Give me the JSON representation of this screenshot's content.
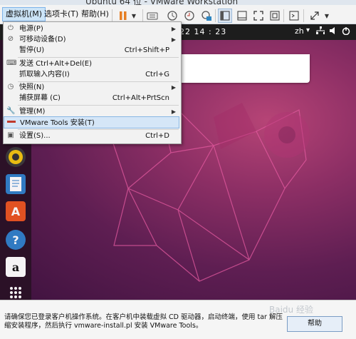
{
  "window": {
    "title": "Ubuntu 64 位 - VMware Workstation"
  },
  "menubar": {
    "items": [
      "虚拟机(M)",
      "选项卡(T)",
      "帮助(H)"
    ]
  },
  "vm": {
    "clock": "22 14 : 23",
    "lang": "zh",
    "tray_icons": [
      "network-icon",
      "volume-icon",
      "power-icon"
    ]
  },
  "dock": {
    "icons": [
      "rhythmbox-icon",
      "writer-icon",
      "software-center-icon",
      "help-icon",
      "amazon-icon",
      "app-grid-icon"
    ]
  },
  "menu": {
    "items": [
      {
        "label": "电源(P)",
        "shortcut": "",
        "submenu": true,
        "icon": "power-icon"
      },
      {
        "label": "可移动设备(D)",
        "shortcut": "",
        "submenu": true,
        "icon": "removable-device-icon"
      },
      {
        "label": "暂停(U)",
        "shortcut": "Ctrl+Shift+P",
        "submenu": false,
        "icon": ""
      },
      {
        "label": "发送 Ctrl+Alt+Del(E)",
        "shortcut": "",
        "submenu": false,
        "icon": "keyboard-icon"
      },
      {
        "label": "抓取输入内容(I)",
        "shortcut": "Ctrl+G",
        "submenu": false,
        "icon": ""
      },
      {
        "label": "快照(N)",
        "shortcut": "",
        "submenu": true,
        "icon": "snapshot-icon"
      },
      {
        "label": "捕获屏幕 (C)",
        "shortcut": "Ctrl+Alt+PrtScn",
        "submenu": false,
        "icon": ""
      },
      {
        "label": "管理(M)",
        "shortcut": "",
        "submenu": true,
        "icon": "wrench-icon"
      },
      {
        "label": "VMware Tools 安装(T)",
        "shortcut": "",
        "submenu": false,
        "icon": ""
      },
      {
        "label": "设置(S)...",
        "shortcut": "Ctrl+D",
        "submenu": false,
        "icon": "settings-icon"
      }
    ]
  },
  "infobar": {
    "text": "请确保您已登录客户机操作系统。在客户机中装载虚拟 CD 驱动器，启动终端，使用 tar 解压缩安装程序，然后执行 vmware-install.pl 安装 VMware Tools。",
    "button": "帮助",
    "watermark": "Baidu 经验"
  },
  "colors": {
    "accent": "#cce4f7",
    "highlight": "#d5e6f7",
    "desktop": "#8d2f65"
  }
}
